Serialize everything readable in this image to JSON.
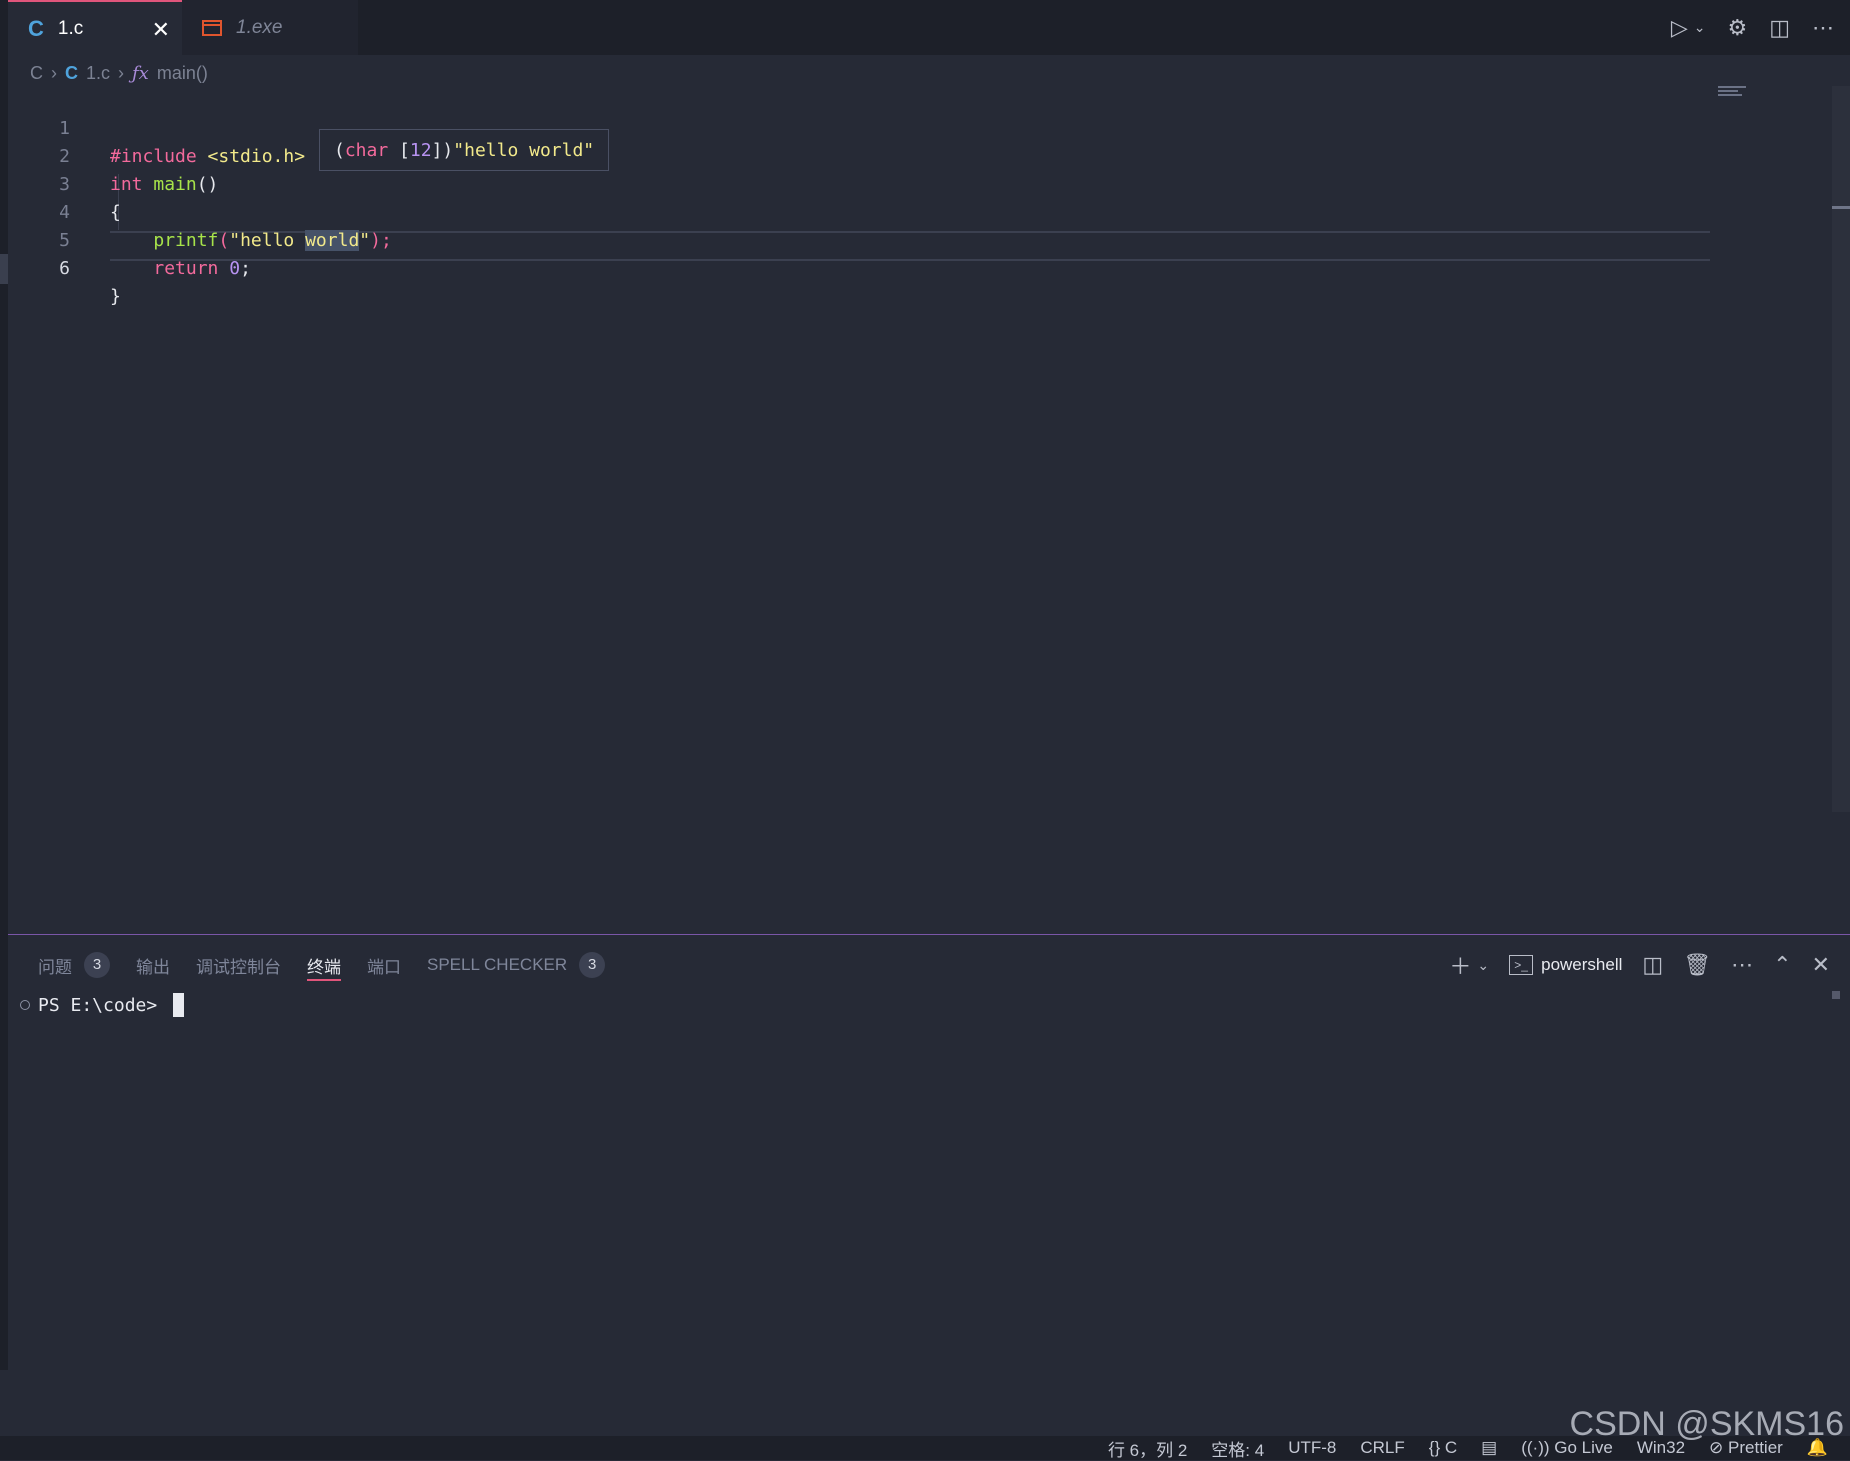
{
  "tabs": [
    {
      "label": "1.c",
      "icon": "c-file-icon",
      "active": true
    },
    {
      "label": "1.exe",
      "icon": "exe-file-icon",
      "active": false
    }
  ],
  "breadcrumb": {
    "root": "C",
    "file": "1.c",
    "symbol_icon": "ƒx",
    "symbol": "main()"
  },
  "editor": {
    "lines": [
      {
        "n": "1"
      },
      {
        "n": "2"
      },
      {
        "n": "3"
      },
      {
        "n": "4"
      },
      {
        "n": "5"
      },
      {
        "n": "6"
      }
    ],
    "code": {
      "l1": {
        "kw": "#include",
        "rest": " <stdio.h>"
      },
      "l2": {
        "kw": "int",
        "fn": "main",
        "rest": "()"
      },
      "l3": {
        "text": "{"
      },
      "l4": {
        "fn": "printf",
        "open": "(",
        "str1": "\"hello ",
        "sel": "world",
        "str2": "\"",
        "close": ");"
      },
      "l5": {
        "kw": "return",
        "num": "0",
        "end": ";"
      },
      "l6": {
        "text": "}"
      }
    },
    "hover": {
      "open": "(",
      "type": "char",
      "sp": " [",
      "num": "12",
      "close": "])",
      "value": "\"hello world\""
    }
  },
  "panel": {
    "tabs": [
      {
        "label": "问题",
        "badge": "3"
      },
      {
        "label": "输出"
      },
      {
        "label": "调试控制台"
      },
      {
        "label": "终端",
        "active": true
      },
      {
        "label": "端口"
      },
      {
        "label": "SPELL CHECKER",
        "badge": "3"
      }
    ],
    "shell_name": "powershell",
    "prompt": "PS E:\\code>"
  },
  "status": {
    "position": "行 6，列 2",
    "spaces": "空格: 4",
    "encoding": "UTF-8",
    "eol": "CRLF",
    "lang_braces": "{}",
    "language": "C",
    "golive": "Go Live",
    "platform": "Win32",
    "prettier": "Prettier"
  },
  "watermark": "CSDN @SKMS16",
  "colors": {
    "accent": "#e0557b",
    "keyword": "#f36a9c",
    "function": "#a7e34a",
    "string": "#f2e98b",
    "number": "#b893f2"
  }
}
